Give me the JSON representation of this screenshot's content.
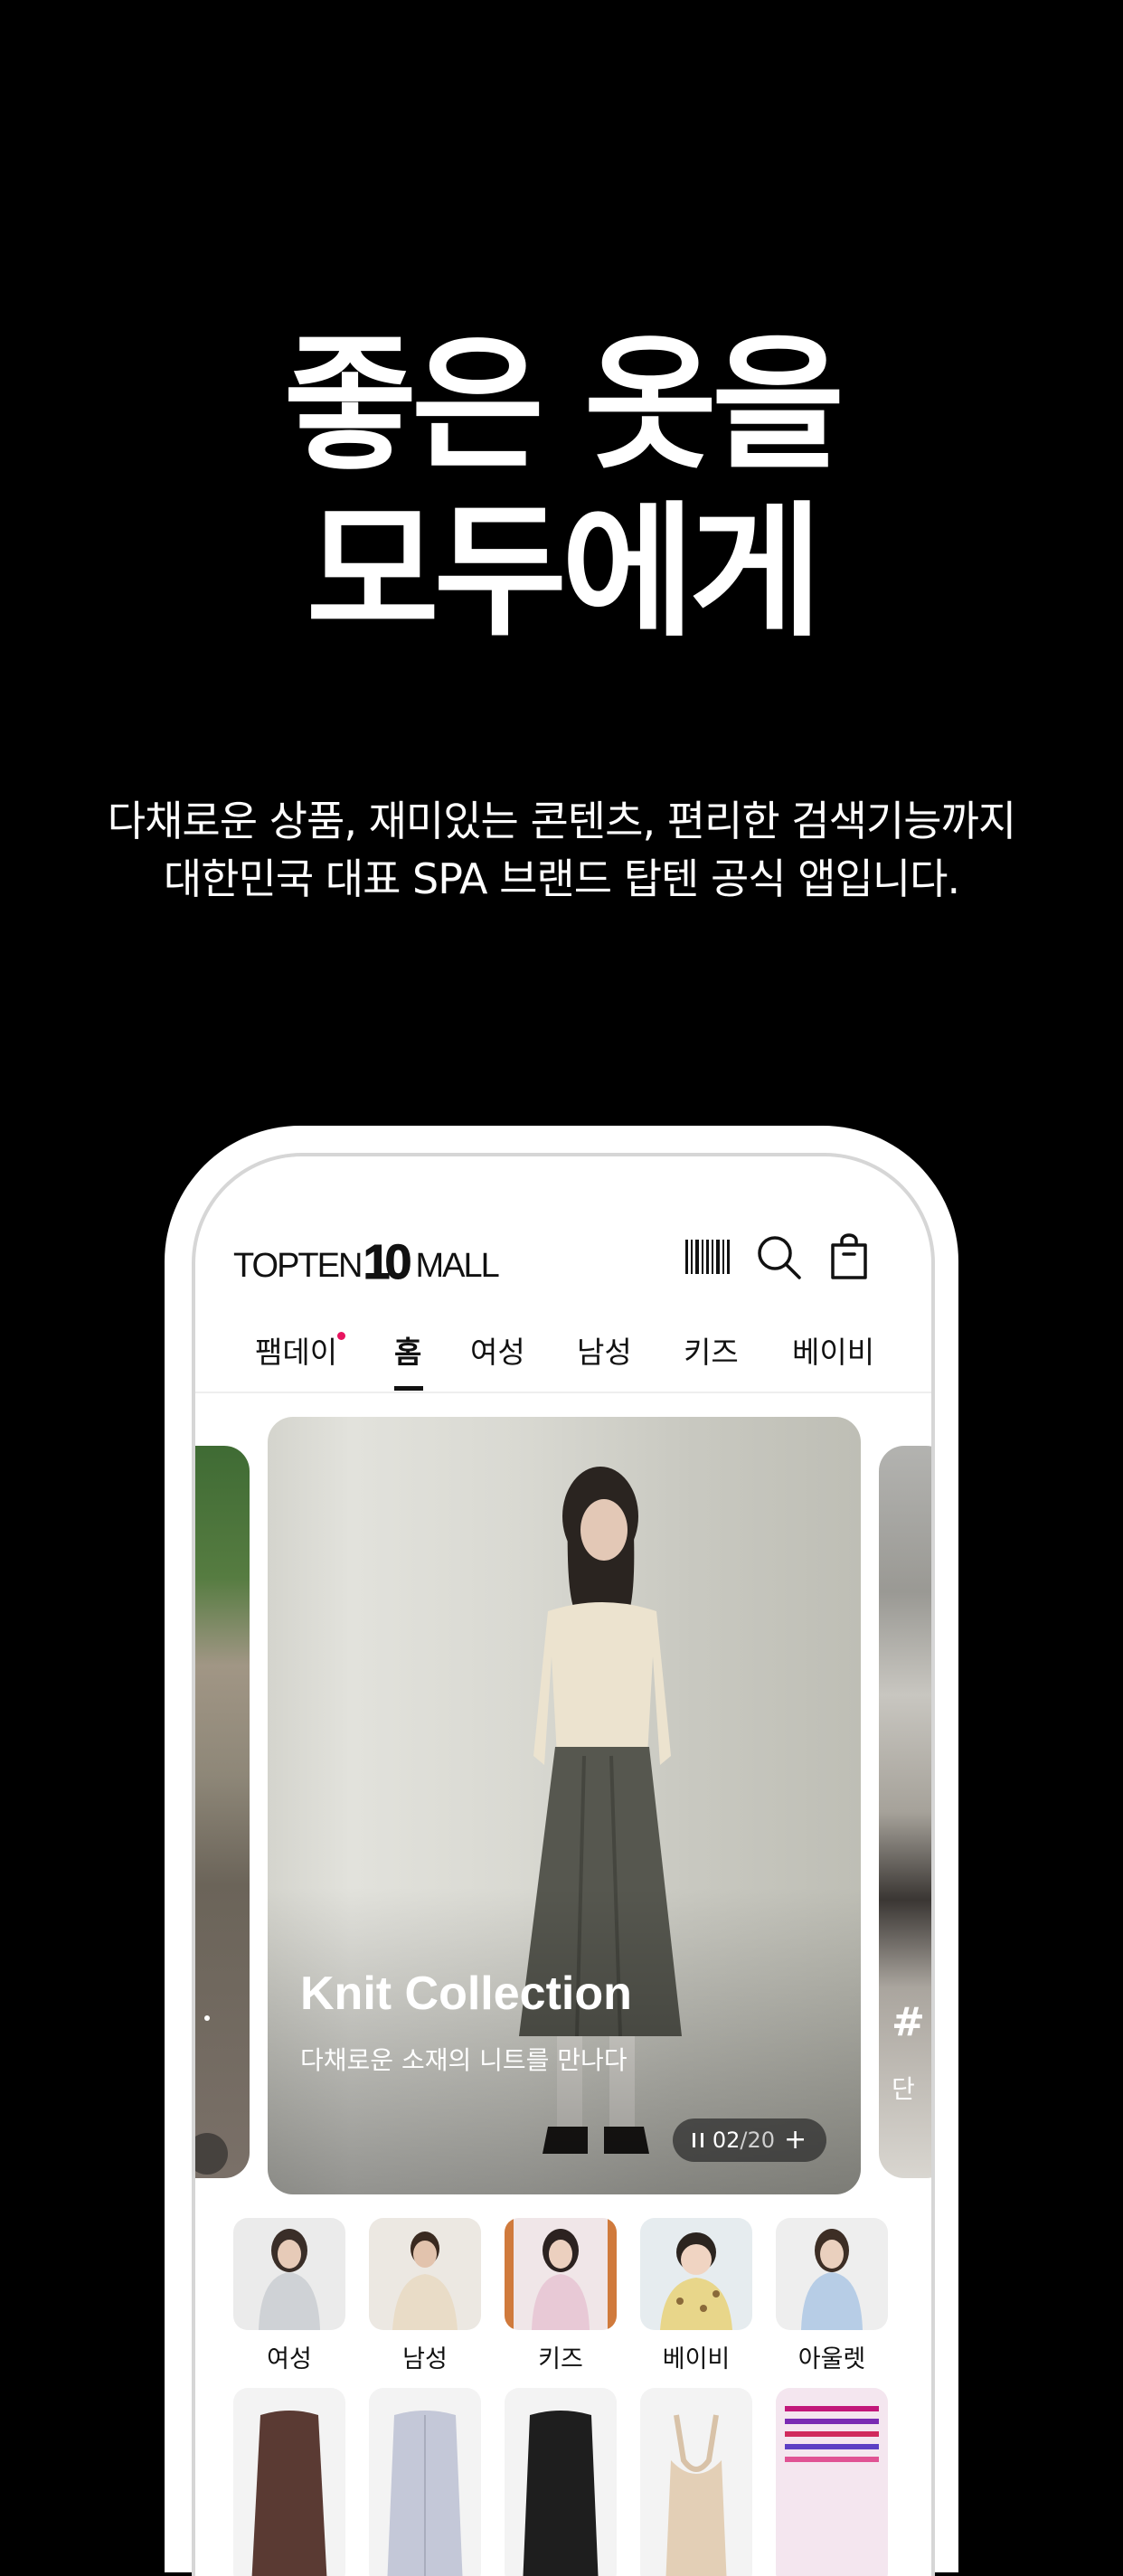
{
  "promo": {
    "headline_line1": "좋은 옷을",
    "headline_line2": "모두에게",
    "subcopy_line1": "다채로운 상품, 재미있는 콘텐츠, 편리한 검색기능까지",
    "subcopy_line2": "대한민국 대표 SPA 브랜드 탑텐 공식 앱입니다."
  },
  "app": {
    "logo": {
      "word1": "TOPTEN",
      "number": "10",
      "word2": "MALL"
    },
    "header_icons": [
      "barcode-icon",
      "search-icon",
      "bag-icon"
    ],
    "tabs": [
      {
        "label": "팸데이",
        "has_dot": true
      },
      {
        "label": "홈",
        "active": true
      },
      {
        "label": "여성"
      },
      {
        "label": "남성"
      },
      {
        "label": "키즈"
      },
      {
        "label": "베이비"
      }
    ],
    "banner": {
      "title": "Knit Collection",
      "subtitle": "다채로운 소재의 니트를 만나다",
      "current": "02",
      "total": "/20",
      "next_peek_title": "#",
      "next_peek_sub": "단"
    },
    "categories": [
      {
        "label": "여성"
      },
      {
        "label": "남성"
      },
      {
        "label": "키즈"
      },
      {
        "label": "베이비"
      },
      {
        "label": "아울렛"
      }
    ],
    "colors": {
      "background": "#000000",
      "accent_dot": "#e8145f",
      "text_dark": "#111111"
    }
  }
}
